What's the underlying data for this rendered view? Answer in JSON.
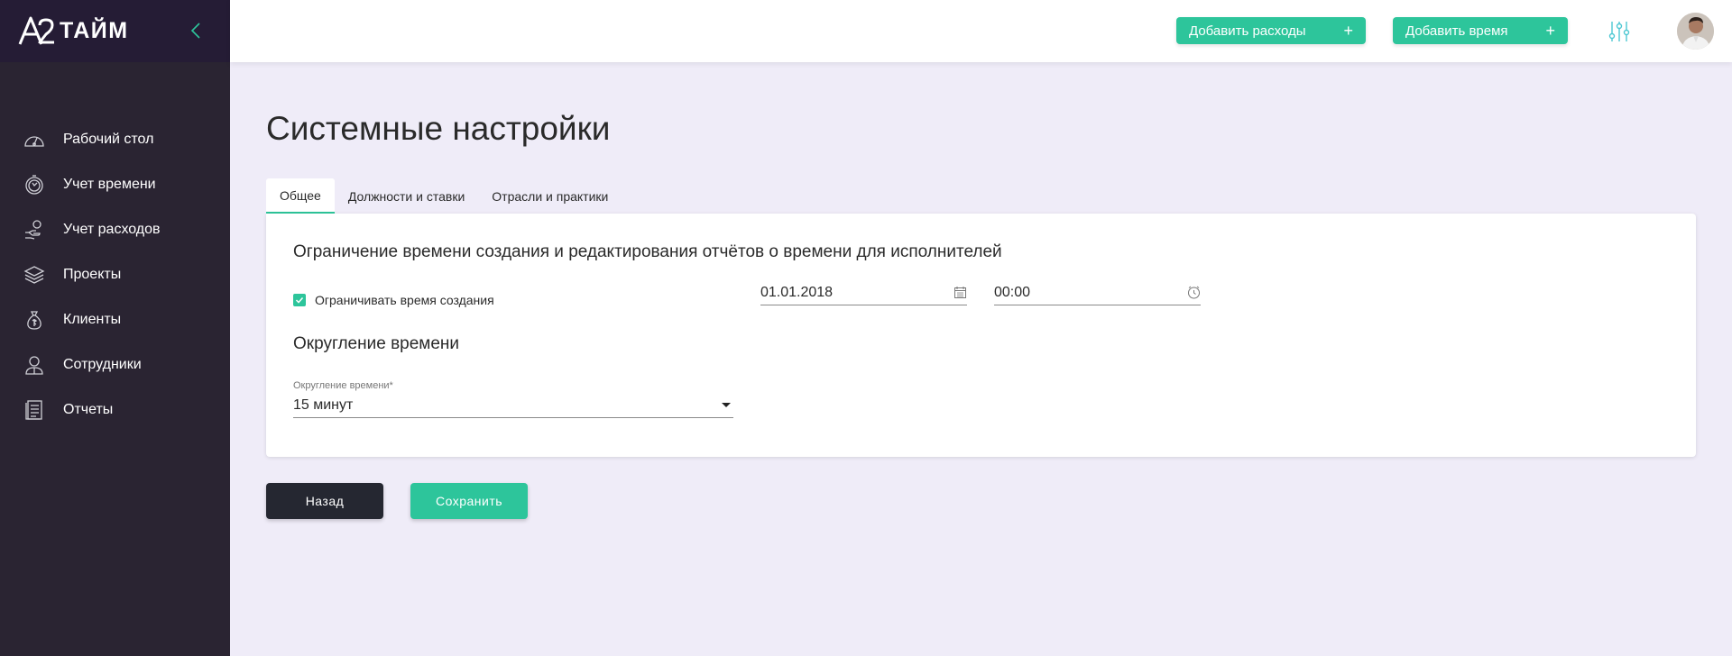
{
  "app": {
    "logo_text": "ТАЙМ",
    "accent_color": "#2dc59b",
    "sidebar_bg": "#2a2432"
  },
  "sidebar": {
    "items": [
      {
        "label": "Рабочий стол",
        "icon": "dashboard-gauge-icon"
      },
      {
        "label": "Учет времени",
        "icon": "stopwatch-icon"
      },
      {
        "label": "Учет расходов",
        "icon": "hand-coin-icon"
      },
      {
        "label": "Проекты",
        "icon": "layers-icon"
      },
      {
        "label": "Клиенты",
        "icon": "money-bag-icon"
      },
      {
        "label": "Сотрудники",
        "icon": "employee-icon"
      },
      {
        "label": "Отчеты",
        "icon": "report-document-icon"
      }
    ]
  },
  "topbar": {
    "add_expenses_label": "Добавить расходы",
    "add_time_label": "Добавить время",
    "plus": "+"
  },
  "page": {
    "title": "Системные настройки",
    "tabs": [
      {
        "label": "Общее",
        "active": true
      },
      {
        "label": "Должности и ставки",
        "active": false
      },
      {
        "label": "Отрасли и практики",
        "active": false
      }
    ]
  },
  "restriction": {
    "title": "Ограничение времени создания и редактирования отчётов о времени для исполнителей",
    "checkbox_label": "Ограничивать время создания",
    "checked": true,
    "date_value": "01.01.2018",
    "time_value": "00:00"
  },
  "rounding": {
    "title": "Округление времени",
    "field_label": "Округление времени*",
    "selected_value": "15 минут"
  },
  "actions": {
    "back_label": "Назад",
    "save_label": "Сохранить"
  }
}
